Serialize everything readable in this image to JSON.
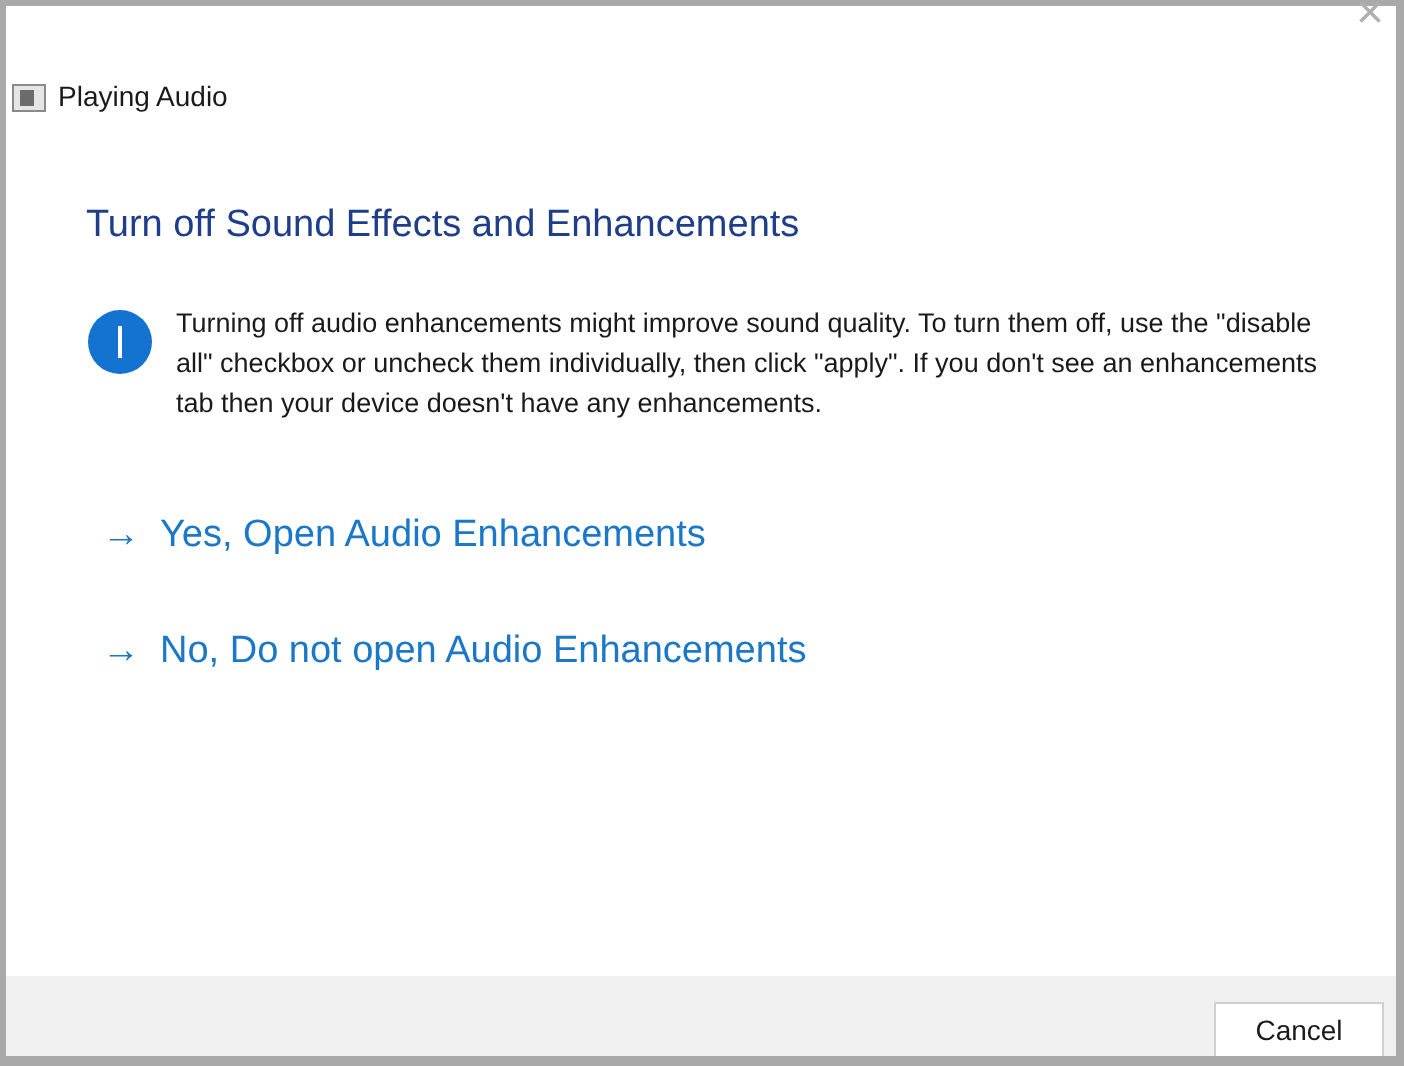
{
  "window": {
    "title": "Playing Audio",
    "close": "×"
  },
  "heading": "Turn off Sound Effects and Enhancements",
  "info": "Turning off audio enhancements might improve sound quality. To turn them off, use the \"disable all\" checkbox or uncheck them individually, then click \"apply\". If you don't see an enhancements tab then your device doesn't have any enhancements.",
  "options": [
    {
      "arrow": "→",
      "label": "Yes, Open Audio Enhancements"
    },
    {
      "arrow": "→",
      "label": "No, Do not open Audio Enhancements"
    }
  ],
  "buttons": [
    "Cancel"
  ]
}
